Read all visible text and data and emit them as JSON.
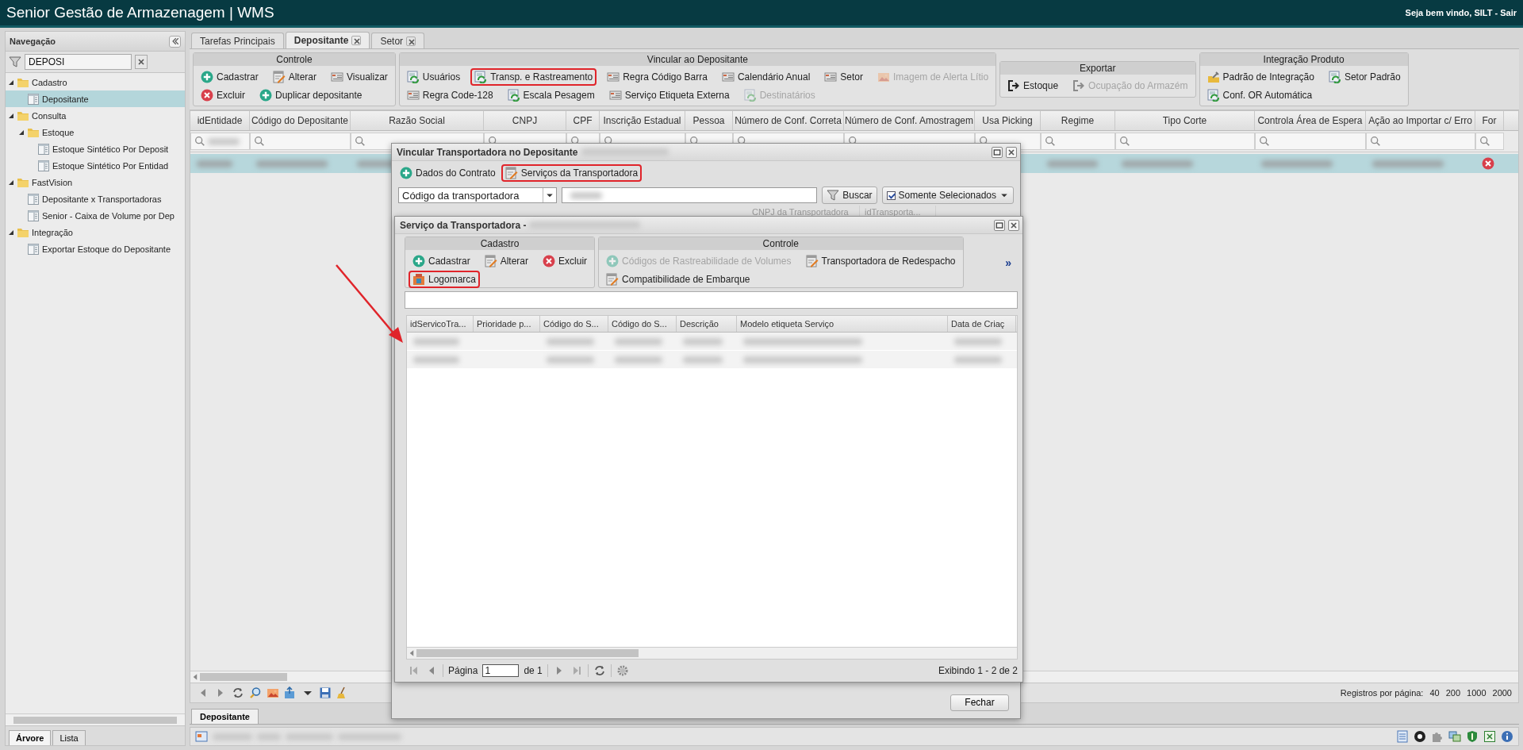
{
  "header": {
    "title": "Senior Gestão de Armazenagem | WMS",
    "greeting": "Seja bem vindo, SILT - ",
    "logout": "Sair"
  },
  "navigation": {
    "title": "Navegação",
    "filter": "DEPOSI",
    "tree": [
      {
        "label": "Cadastro",
        "expanded": true,
        "selected": false,
        "children": [
          {
            "label": "Depositante",
            "selected": true
          }
        ]
      },
      {
        "label": "Consulta",
        "expanded": true,
        "selected": false,
        "children": [
          {
            "label": "Estoque",
            "expanded": true,
            "selected": false,
            "children": [
              {
                "label": "Estoque Sintético Por Deposit",
                "selected": false
              },
              {
                "label": "Estoque Sintético Por Entidad",
                "selected": false
              }
            ]
          }
        ]
      },
      {
        "label": "FastVision",
        "expanded": true,
        "selected": false,
        "children": [
          {
            "label": "Depositante x Transportadoras",
            "selected": false
          },
          {
            "label": "Senior - Caixa de Volume por Dep",
            "selected": false
          }
        ]
      },
      {
        "label": "Integração",
        "expanded": true,
        "selected": false,
        "children": [
          {
            "label": "Exportar Estoque do Depositante",
            "selected": false
          }
        ]
      }
    ],
    "tabs": [
      {
        "label": "Árvore",
        "selected": true
      },
      {
        "label": "Lista",
        "selected": false
      }
    ]
  },
  "tabs": [
    {
      "label": "Tarefas Principais",
      "selected": false,
      "closable": false
    },
    {
      "label": "Depositante",
      "selected": true,
      "closable": true
    },
    {
      "label": "Setor",
      "selected": false,
      "closable": true
    }
  ],
  "ribbon": [
    {
      "title": "Controle",
      "rows": [
        [
          {
            "label": "Cadastrar",
            "kind": "add",
            "disabled": false,
            "highlighted": false
          },
          {
            "label": "Alterar",
            "kind": "edit",
            "disabled": false,
            "highlighted": false
          },
          {
            "label": "Visualizar",
            "kind": "view",
            "disabled": false,
            "highlighted": false
          }
        ],
        [
          {
            "label": "Excluir",
            "kind": "delete",
            "disabled": false,
            "highlighted": false
          },
          {
            "label": "Duplicar depositante",
            "kind": "add",
            "disabled": false,
            "highlighted": false
          }
        ]
      ]
    },
    {
      "title": "Vincular ao Depositante",
      "rows": [
        [
          {
            "label": "Usuários",
            "kind": "link",
            "disabled": false,
            "highlighted": false
          },
          {
            "label": "Transp. e Rastreamento",
            "kind": "link",
            "disabled": false,
            "highlighted": true
          },
          {
            "label": "Regra Código Barra",
            "kind": "view",
            "disabled": false,
            "highlighted": false
          },
          {
            "label": "Calendário Anual",
            "kind": "view",
            "disabled": false,
            "highlighted": false
          },
          {
            "label": "Setor",
            "kind": "view",
            "disabled": false,
            "highlighted": false
          },
          {
            "label": "Imagem de Alerta Lítio",
            "kind": "image",
            "disabled": true,
            "highlighted": false
          }
        ],
        [
          {
            "label": "Regra Code-128",
            "kind": "view",
            "disabled": false,
            "highlighted": false
          },
          {
            "label": "Escala Pesagem",
            "kind": "link",
            "disabled": false,
            "highlighted": false
          },
          {
            "label": "Serviço Etiqueta Externa",
            "kind": "view",
            "disabled": false,
            "highlighted": false
          },
          {
            "label": "Destinatários",
            "kind": "link",
            "disabled": true,
            "highlighted": false
          }
        ]
      ]
    },
    {
      "title": "Exportar",
      "rows": [
        [
          {
            "label": "Estoque",
            "kind": "export",
            "disabled": false,
            "highlighted": false
          },
          {
            "label": "Ocupação do Armazém",
            "kind": "export",
            "disabled": true,
            "highlighted": false
          }
        ]
      ]
    },
    {
      "title": "Integração Produto",
      "rows": [
        [
          {
            "label": "Padrão de Integração",
            "kind": "config",
            "disabled": false,
            "highlighted": false
          },
          {
            "label": "Setor Padrão",
            "kind": "link",
            "disabled": false,
            "highlighted": false
          }
        ],
        [
          {
            "label": "Conf. OR Automática",
            "kind": "link",
            "disabled": false,
            "highlighted": false
          }
        ]
      ]
    }
  ],
  "grid": {
    "columns": [
      "idEntidade",
      "Código do Depositante",
      "Razão Social",
      "CNPJ",
      "CPF",
      "Inscrição Estadual",
      "Pessoa",
      "Número de Conf. Correta",
      "Número de Conf. Amostragem",
      "Usa Picking",
      "Regime",
      "Tipo Corte",
      "Controla Área de Espera",
      "Ação ao Importar c/ Erro",
      "For"
    ],
    "rows": [
      {
        "selected": true
      }
    ],
    "records_per_page": {
      "label": "Registros por página:",
      "options": [
        "40",
        "200",
        "1000",
        "2000"
      ]
    }
  },
  "bottom_tab": "Depositante",
  "dialog_carriers": {
    "title": "Vincular Transportadora no Depositante",
    "buttons": [
      {
        "label": "Dados do Contrato",
        "kind": "add",
        "highlighted": false
      },
      {
        "label": "Serviços da Transportadora",
        "kind": "edit",
        "highlighted": true
      }
    ],
    "search": {
      "field": "Código da transportadora",
      "button": "Buscar",
      "only_selected": {
        "label": "Somente Selecionados",
        "checked": true
      }
    },
    "columns": [
      "CNPJ da Transportadora",
      "idTransporta..."
    ],
    "close_button": "Fechar"
  },
  "dialog_services": {
    "title": "Serviço da Transportadora - ",
    "groups": [
      {
        "title": "Cadastro",
        "rows": [
          [
            {
              "label": "Cadastrar",
              "kind": "add",
              "disabled": false,
              "highlighted": false
            },
            {
              "label": "Alterar",
              "kind": "edit",
              "disabled": false,
              "highlighted": false
            },
            {
              "label": "Excluir",
              "kind": "delete",
              "disabled": false,
              "highlighted": false
            }
          ],
          [
            {
              "label": "Logomarca",
              "kind": "logo",
              "disabled": false,
              "highlighted": true
            }
          ]
        ]
      },
      {
        "title": "Controle",
        "rows": [
          [
            {
              "label": "Códigos de Rastreabilidade de Volumes",
              "kind": "add",
              "disabled": true,
              "highlighted": false
            },
            {
              "label": "Transportadora de Redespacho",
              "kind": "edit",
              "disabled": false,
              "highlighted": false
            }
          ],
          [
            {
              "label": "Compatibilidade de Embarque",
              "kind": "edit",
              "disabled": false,
              "highlighted": false
            }
          ]
        ]
      }
    ],
    "more": "»",
    "columns": [
      "idServicoTra...",
      "Prioridade p...",
      "Código do S...",
      "Código do S...",
      "Descrição",
      "Modelo etiqueta Serviço",
      "Data de Criaç"
    ],
    "paging": {
      "page_label": "Página",
      "page": "1",
      "of": "de 1",
      "summary": "Exibindo 1 - 2 de 2"
    }
  }
}
